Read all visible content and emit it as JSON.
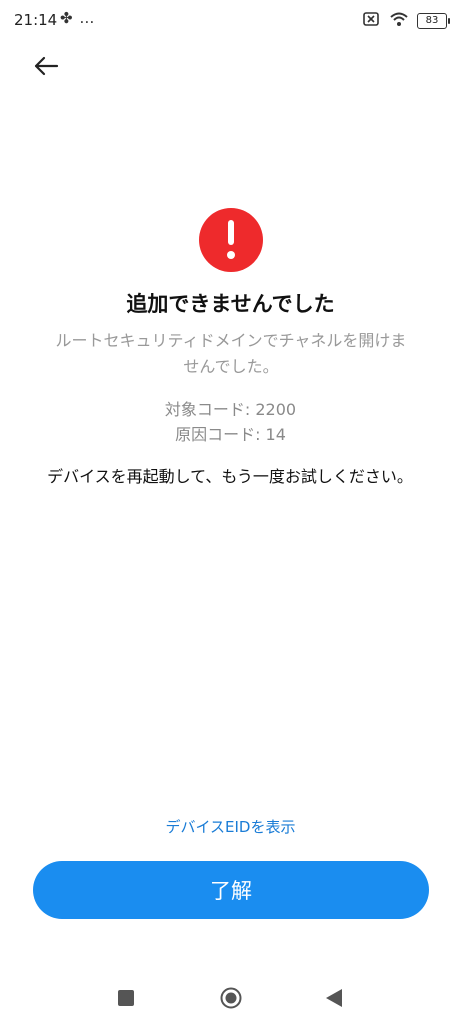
{
  "status_bar": {
    "time": "21:14",
    "left_icons": "✤ …",
    "battery": "83"
  },
  "dialog": {
    "title": "追加できませんでした",
    "subtitle": "ルートセキュリティドメインでチャネルを開けませんでした。",
    "target_code": "対象コード: 2200",
    "cause_code": "原因コード: 14",
    "instruction": "デバイスを再起動して、もう一度お試しください。"
  },
  "actions": {
    "show_eid": "デバイスEIDを表示",
    "ok": "了解"
  },
  "colors": {
    "alert_red": "#ee2a2c",
    "accent_blue": "#1a8df0",
    "link_blue": "#1a7cd6"
  }
}
